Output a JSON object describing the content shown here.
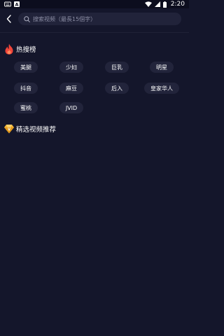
{
  "status_bar": {
    "time": "2:20",
    "left_icons": [
      "keyboard-icon",
      "a-notification-icon"
    ],
    "right_icons": [
      "wifi-icon",
      "signal-icon",
      "battery-icon"
    ]
  },
  "search": {
    "placeholder": "搜索视频（最長15個字）"
  },
  "hot_section": {
    "title": "热搜榜",
    "icon": "fire-icon",
    "tags": [
      "美腿",
      "少妇",
      "巨乳",
      "明星",
      "抖音",
      "麻豆",
      "后入",
      "皇家华人",
      "蜜桃",
      "JVID"
    ]
  },
  "recommend_section": {
    "title": "精选视频推荐",
    "icon": "diamond-icon"
  },
  "colors": {
    "background": "#14162b",
    "tag_background": "#22243b",
    "search_background": "#21233a",
    "fire": "#f0453a",
    "diamond": "#f5b63b"
  }
}
